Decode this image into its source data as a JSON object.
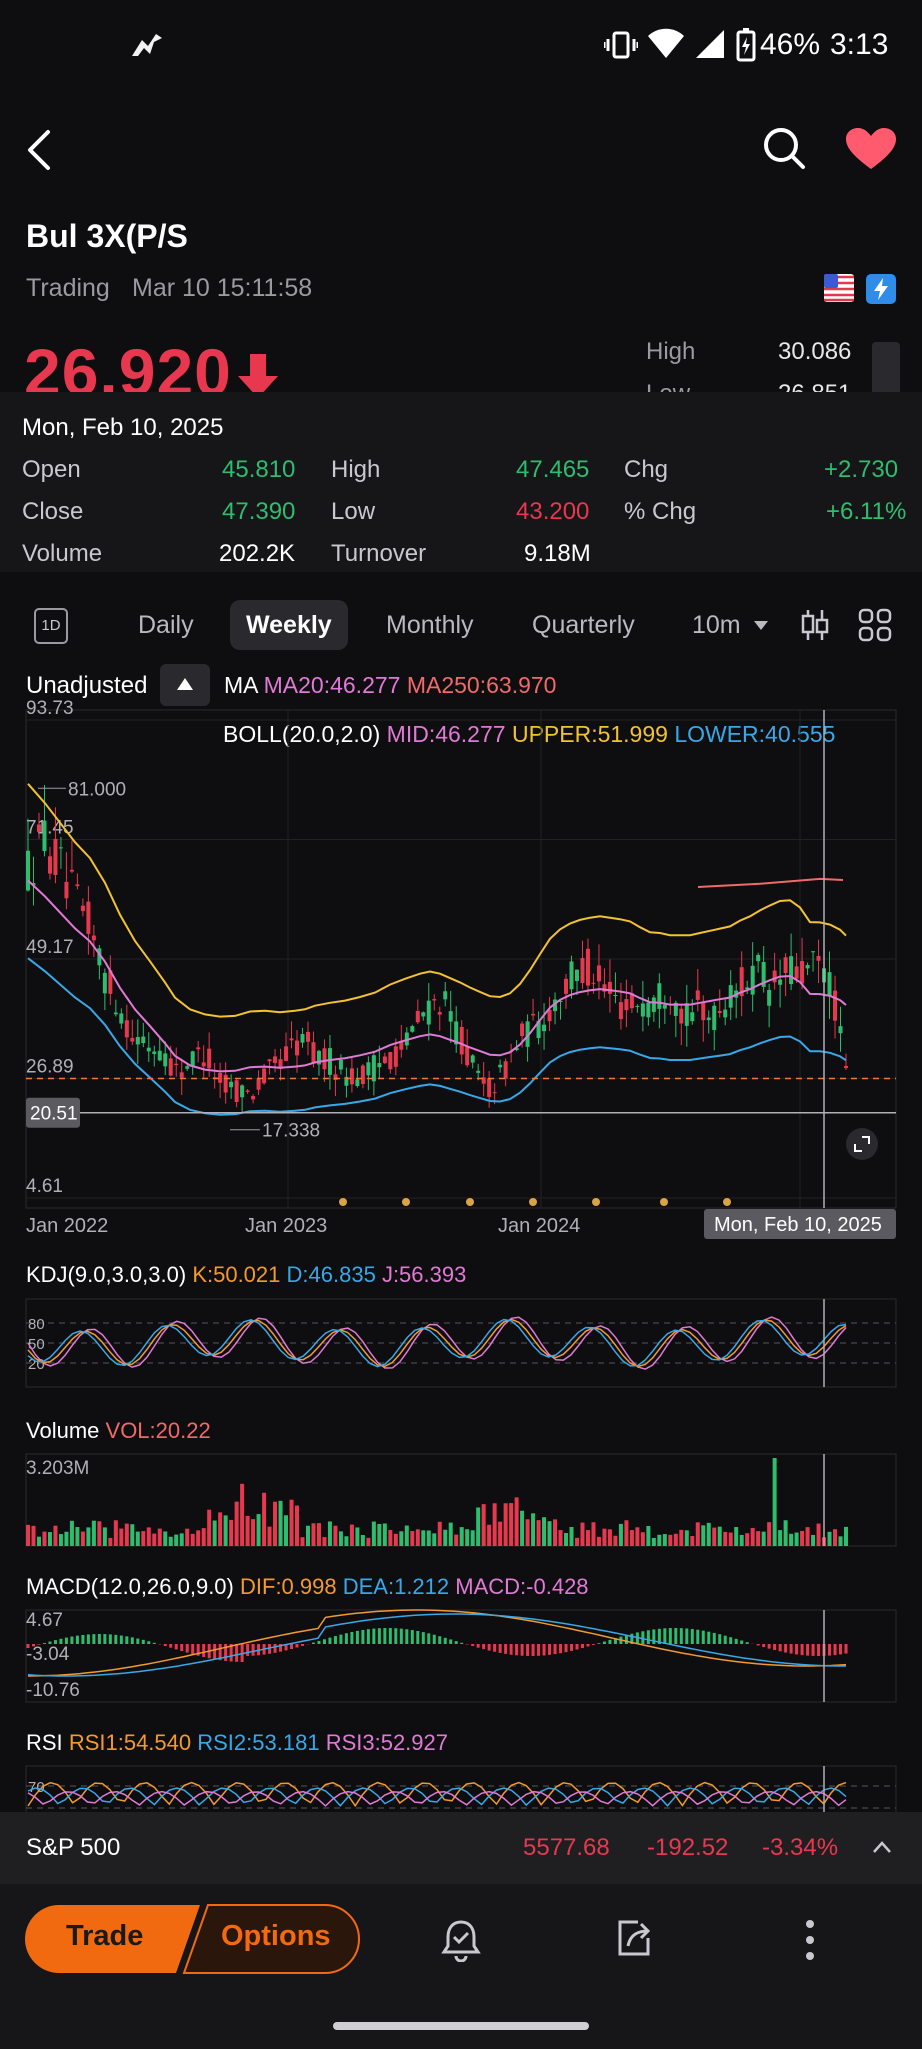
{
  "status_bar": {
    "time": "3:13",
    "battery": "46%"
  },
  "header": {
    "title": "Bul 3X(P/S",
    "trading_label": "Trading",
    "timestamp": "Mar 10 15:11:58"
  },
  "quote": {
    "price": "26.920",
    "high_label": "High",
    "high_value": "30.086",
    "low_label": "Low",
    "low_value": "26.851"
  },
  "candle_info": {
    "date": "Mon, Feb 10, 2025",
    "open_label": "Open",
    "open_value": "45.810",
    "close_label": "Close",
    "close_value": "47.390",
    "volume_label": "Volume",
    "volume_value": "202.2K",
    "high_label": "High",
    "high_value": "47.465",
    "low_label": "Low",
    "low_value": "43.200",
    "turnover_label": "Turnover",
    "turnover_value": "9.18M",
    "chg_label": "Chg",
    "chg_value": "+2.730",
    "pchg_label": "% Chg",
    "pchg_value": "+6.11%"
  },
  "periods": {
    "oneday": "1D",
    "daily": "Daily",
    "weekly": "Weekly",
    "monthly": "Monthly",
    "quarterly": "Quarterly",
    "interval": "10m"
  },
  "main_chart": {
    "adjust_label": "Unadjusted",
    "ma_label": "MA",
    "ma20": "MA20:46.277",
    "ma250": "MA250:63.970",
    "boll_label": "BOLL(20.0,2.0)",
    "boll_mid": "MID:46.277",
    "boll_upper": "UPPER:51.999",
    "boll_lower": "LOWER:40.555",
    "y_ticks": [
      "93.73",
      "71.45",
      "49.17",
      "26.89",
      "4.61"
    ],
    "x_ticks": [
      "Jan 2022",
      "Jan 2023",
      "Jan 2024"
    ],
    "max_label": "81.000",
    "min_label": "17.338",
    "crosshair_price": "20.51",
    "crosshair_date": "Mon, Feb 10, 2025",
    "colors": {
      "up": "#2ebd6f",
      "down": "#e8384f",
      "upper": "#f2c230",
      "mid": "#e07ad6",
      "lower": "#38a8e8",
      "ma250": "#f06a6a"
    }
  },
  "kdj": {
    "label": "KDJ(9.0,3.0,3.0)",
    "k": "K:50.021",
    "d": "D:46.835",
    "j": "J:56.393",
    "levels": [
      "80",
      "50",
      "20"
    ]
  },
  "volume": {
    "label": "Volume",
    "vol": "VOL:20.22",
    "max": "3.203M"
  },
  "macd": {
    "label": "MACD(12.0,26.0,9.0)",
    "dif": "DIF:0.998",
    "dea": "DEA:1.212",
    "macd": "MACD:-0.428",
    "ticks": [
      "4.67",
      "-3.04",
      "-10.76"
    ]
  },
  "rsi": {
    "label": "RSI",
    "rsi1": "RSI1:54.540",
    "rsi2": "RSI2:53.181",
    "rsi3": "RSI3:52.927",
    "ticks": [
      "70"
    ]
  },
  "index_bar": {
    "name": "S&P 500",
    "value": "5577.68",
    "change": "-192.52",
    "pct": "-3.34%"
  },
  "bottom_bar": {
    "trade": "Trade",
    "options": "Options"
  }
}
